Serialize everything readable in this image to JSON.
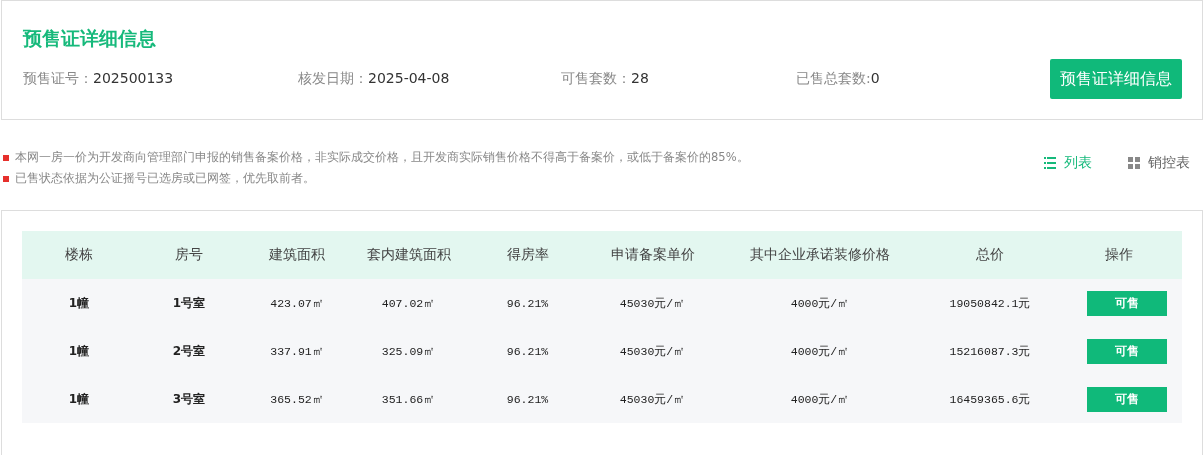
{
  "header": {
    "title": "预售证详细信息",
    "fields": [
      {
        "label": "预售证号：",
        "value": "202500133"
      },
      {
        "label": "核发日期：",
        "value": "2025-04-08"
      },
      {
        "label": "可售套数：",
        "value": "28"
      },
      {
        "label": "已售总套数:",
        "value": "0"
      }
    ],
    "button": "预售证详细信息"
  },
  "notes": [
    "本网一房一价为开发商向管理部门申报的销售备案价格，非实际成交价格，且开发商实际销售价格不得高于备案价，或低于备案价的85%。",
    "已售状态依据为公证摇号已选房或已网签，优先取前者。"
  ],
  "views": [
    {
      "label": "列表",
      "kind": "list",
      "selected": true
    },
    {
      "label": "销控表",
      "kind": "grid",
      "selected": false
    }
  ],
  "table": {
    "columns": [
      "楼栋",
      "房号",
      "建筑面积",
      "套内建筑面积",
      "得房率",
      "申请备案单价",
      "其中企业承诺装修价格",
      "总价",
      "操作"
    ],
    "rows": [
      {
        "cells": [
          "1幢",
          "1号室",
          "423.07㎡",
          "407.02㎡",
          "96.21%",
          "45030元/㎡",
          "4000元/㎡",
          "19050842.1元"
        ],
        "action": "可售"
      },
      {
        "cells": [
          "1幢",
          "2号室",
          "337.91㎡",
          "325.09㎡",
          "96.21%",
          "45030元/㎡",
          "4000元/㎡",
          "15216087.3元"
        ],
        "action": "可售"
      },
      {
        "cells": [
          "1幢",
          "3号室",
          "365.52㎡",
          "351.66㎡",
          "96.21%",
          "45030元/㎡",
          "4000元/㎡",
          "16459365.6元"
        ],
        "action": "可售"
      }
    ]
  }
}
